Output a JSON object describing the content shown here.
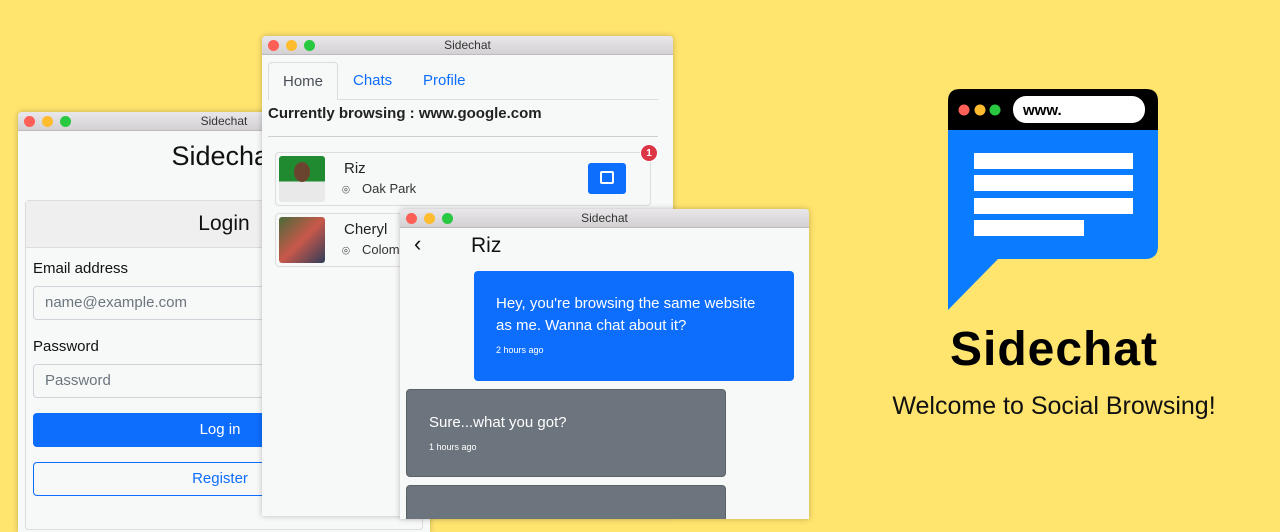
{
  "login_window": {
    "title": "Sidechat",
    "heading": "Sidechat",
    "card_title": "Login",
    "email_label": "Email address",
    "email_placeholder": "name@example.com",
    "password_label": "Password",
    "password_placeholder": "Password",
    "login_button": "Log in",
    "register_button": "Register"
  },
  "home_window": {
    "title": "Sidechat",
    "tabs": [
      {
        "label": "Home",
        "active": true
      },
      {
        "label": "Chats"
      },
      {
        "label": "Profile"
      }
    ],
    "browsing": "Currently browsing : www.google.com",
    "users": [
      {
        "name": "Riz",
        "location": "Oak Park",
        "badge": "1"
      },
      {
        "name": "Cheryl",
        "location": "Colom"
      }
    ]
  },
  "chat_window": {
    "title": "Sidechat",
    "contact": "Riz",
    "messages": [
      {
        "text": "Hey, you're browsing the same website as me. Wanna chat about it?",
        "time": "2 hours ago",
        "mine": true
      },
      {
        "text": "Sure...what you got?",
        "time": "1 hours ago",
        "mine": false
      },
      {
        "text": "",
        "time": "",
        "mine": false
      }
    ]
  },
  "brand": {
    "logo_url_text": "www.",
    "name": "Sidechat",
    "tagline": "Welcome to Social Browsing!"
  },
  "colors": {
    "background": "#ffe46e",
    "primary": "#0d6efd",
    "secondary": "#6c757d",
    "badge": "#dc3545"
  }
}
